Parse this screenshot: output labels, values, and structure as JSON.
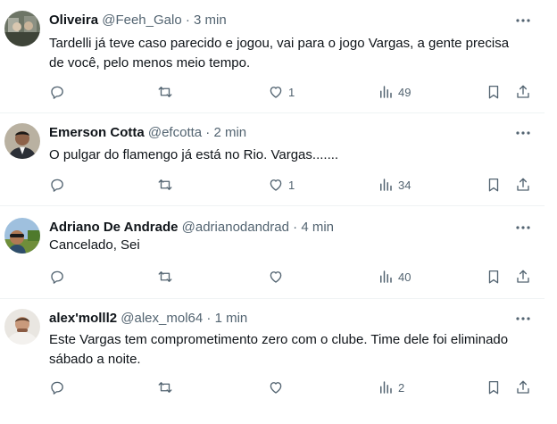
{
  "tweets": [
    {
      "name": "Oliveira",
      "handle": "@Feeh_Galo",
      "separator": " · ",
      "time": "3 min",
      "text": "Tardelli já teve caso parecido e jogou, vai para o jogo Vargas, a gente precisa de você, pelo menos meio tempo.",
      "likes": "1",
      "views": "49"
    },
    {
      "name": "Emerson Cotta",
      "handle": "@efcotta",
      "separator": " · ",
      "time": "2 min",
      "text": "O pulgar do flamengo já está no Rio. Vargas.......",
      "likes": "1",
      "views": "34"
    },
    {
      "name": "Adriano De Andrade",
      "handle": "@adrianodandrad",
      "separator": " · ",
      "time": "4 min",
      "text": "Cancelado, Sei",
      "likes": "",
      "views": "40"
    },
    {
      "name": "alex'molll2",
      "handle": "@alex_mol64",
      "separator": " · ",
      "time": "1 min",
      "text": "Este Vargas tem comprometimento zero com o clube. Time dele foi eliminado sábado a noite.",
      "likes": "",
      "views": "2"
    }
  ],
  "icons": {
    "reply": "reply-icon",
    "retweet": "retweet-icon",
    "like": "heart-icon",
    "views": "views-icon",
    "bookmark": "bookmark-icon",
    "share": "share-icon",
    "more": "more-icon"
  },
  "colors": {
    "text": "#0f1419",
    "secondary": "#536471",
    "divider": "#eff3f4"
  }
}
